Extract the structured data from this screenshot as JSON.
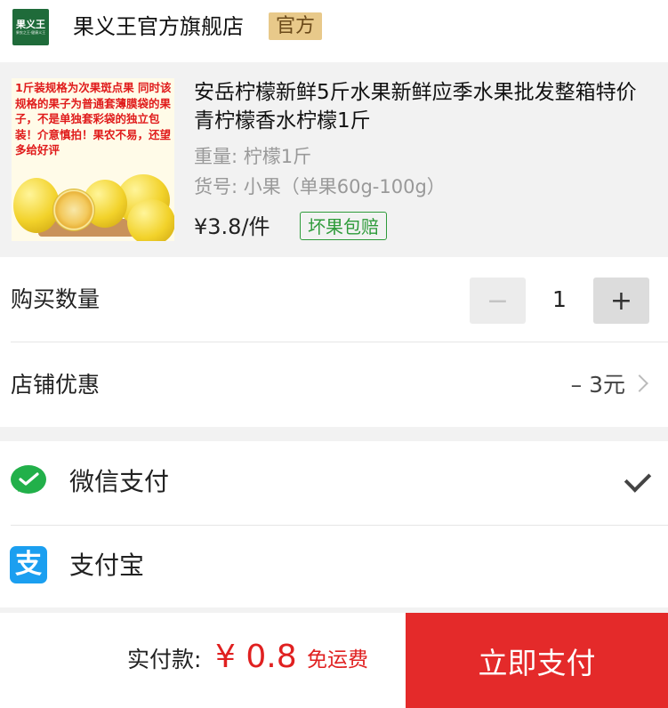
{
  "store": {
    "logo_text": "果义王",
    "logo_sub": "果农之王·健康义王",
    "name": "果义王官方旗舰店",
    "badge": "官方"
  },
  "product": {
    "image_text": "1斤装规格为次果斑点果 同时该规格的果子为普通套薄膜袋的果子，不是单独套彩袋的独立包装！介意慎拍！果农不易，还望多给好评",
    "title": "安岳柠檬新鲜5斤水果新鲜应季水果批发整箱特价青柠檬香水柠檬1斤",
    "spec_weight": "重量: 柠檬1斤",
    "spec_item": "货号: 小果（单果60g-100g）",
    "price": "¥3.8/件",
    "guarantee": "坏果包赔"
  },
  "quantity": {
    "label": "购买数量",
    "minus": "−",
    "plus": "+",
    "value": "1"
  },
  "discount": {
    "label": "店铺优惠",
    "value": "– 3元"
  },
  "payment": {
    "wechat_label": "微信支付",
    "alipay_label": "支付宝",
    "alipay_glyph": "支",
    "selected": "wechat"
  },
  "footer": {
    "total_label": "实付款:",
    "total_amount": "¥ 0.8",
    "shipping": "免运费",
    "pay_button": "立即支付"
  },
  "colors": {
    "accent_red": "#e42a2a",
    "wechat_green": "#22b04a",
    "alipay_blue": "#1b9ff0",
    "official_gold": "#e8c98a",
    "guarantee_green": "#2e9b3a"
  },
  "icons": [
    "chevron-right-icon",
    "checkmark-icon",
    "wechat-pay-icon",
    "alipay-icon"
  ]
}
